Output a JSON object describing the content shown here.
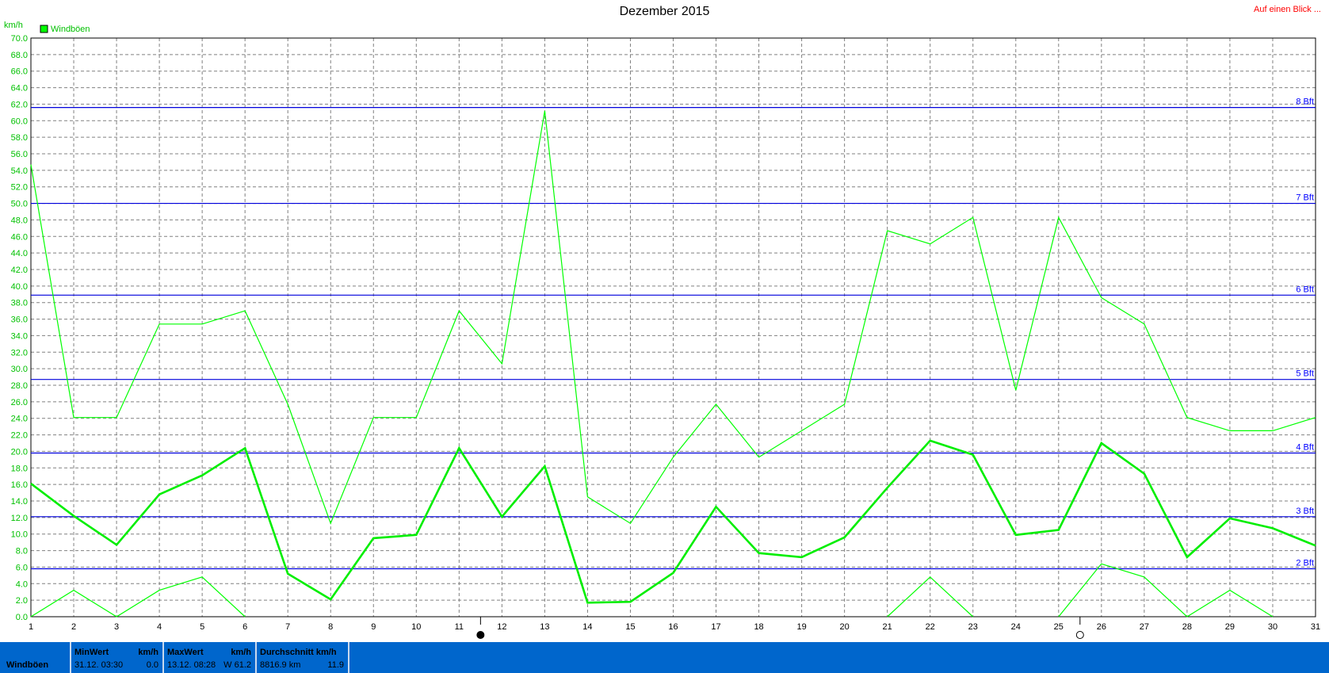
{
  "header": {
    "title": "Dezember 2015",
    "quick_link": "Auf einen Blick ..."
  },
  "chart_data": {
    "type": "line",
    "unit_label": "km/h",
    "legend": "Windböen",
    "x": [
      1,
      2,
      3,
      4,
      5,
      6,
      7,
      8,
      9,
      10,
      11,
      12,
      13,
      14,
      15,
      16,
      17,
      18,
      19,
      20,
      21,
      22,
      23,
      24,
      25,
      26,
      27,
      28,
      29,
      30,
      31
    ],
    "series": [
      {
        "name": "Windböen",
        "role": "max",
        "color": "#00ff00",
        "values": [
          54.7,
          24.1,
          24.1,
          35.4,
          35.4,
          37.0,
          25.7,
          11.3,
          24.1,
          24.1,
          37.0,
          30.6,
          61.2,
          14.5,
          11.3,
          19.3,
          25.7,
          19.3,
          22.5,
          25.7,
          46.7,
          45.1,
          48.3,
          27.4,
          48.3,
          38.6,
          35.4,
          24.1,
          22.5,
          22.5,
          24.1
        ]
      },
      {
        "name": "Windböen",
        "role": "avg",
        "color": "#00ee00",
        "values": [
          16.1,
          12.2,
          8.7,
          14.8,
          17.1,
          20.4,
          5.2,
          2.1,
          9.5,
          9.9,
          20.4,
          12.1,
          18.2,
          1.7,
          1.8,
          5.3,
          13.3,
          7.7,
          7.2,
          9.6,
          15.6,
          21.3,
          19.6,
          9.9,
          10.5,
          21.0,
          17.3,
          7.2,
          11.9,
          10.7,
          8.6
        ]
      },
      {
        "name": "Windböen",
        "role": "min",
        "color": "#00ff00",
        "values": [
          0.0,
          3.2,
          0.0,
          3.2,
          4.8,
          0.0,
          null,
          null,
          null,
          null,
          null,
          null,
          null,
          null,
          null,
          null,
          null,
          null,
          null,
          null,
          0.0,
          4.8,
          0.0,
          null,
          0.0,
          6.4,
          4.8,
          0.0,
          3.2,
          0.0,
          null
        ]
      }
    ],
    "ylim": [
      0,
      70
    ],
    "ytick_step": 2,
    "xticks": [
      "1",
      "2",
      "3",
      "4",
      "5",
      "6",
      "7",
      "8",
      "9",
      "10",
      "11",
      "12",
      "13",
      "14",
      "15",
      "16",
      "17",
      "18",
      "19",
      "20",
      "21",
      "22",
      "23",
      "24",
      "25",
      "26",
      "27",
      "28",
      "29",
      "30",
      "31"
    ],
    "beaufort_lines": [
      {
        "label": "2 Bft",
        "value": 5.8
      },
      {
        "label": "3 Bft",
        "value": 12.1
      },
      {
        "label": "4 Bft",
        "value": 19.8
      },
      {
        "label": "5 Bft",
        "value": 28.7
      },
      {
        "label": "6 Bft",
        "value": 38.9
      },
      {
        "label": "7 Bft",
        "value": 50.0
      },
      {
        "label": "8 Bft",
        "value": 61.6
      }
    ],
    "grid": true,
    "legend_position": "top-left",
    "moon_markers": [
      {
        "x": 11.5,
        "phase": "new-moon"
      },
      {
        "x": 25.5,
        "phase": "full-moon"
      }
    ],
    "colors": {
      "line": "#00ff00",
      "axis_text": "#00c000",
      "bft_line": "#0000dd",
      "bft_text": "#0000ff",
      "grid": "#808080"
    }
  },
  "footer": {
    "row_label": "Windböen",
    "min": {
      "header": "MinWert",
      "unit": "km/h",
      "date": "31.12.  03:30",
      "value": "0.0"
    },
    "max": {
      "header": "MaxWert",
      "unit": "km/h",
      "date": "13.12.  08:28",
      "value": "W 61.2"
    },
    "avg": {
      "header": "Durchschnitt km/h",
      "distance": "8816.9 km",
      "value": "11.9"
    }
  }
}
